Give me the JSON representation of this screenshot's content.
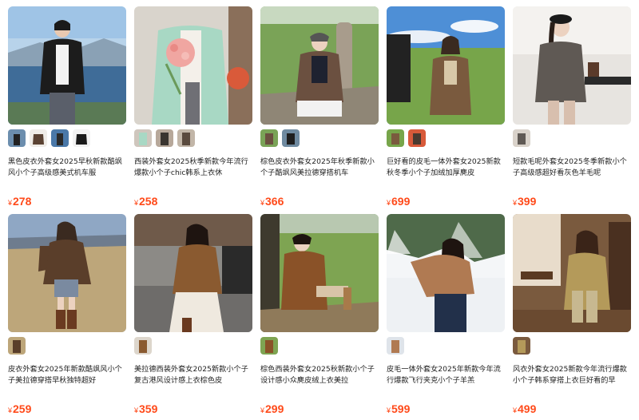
{
  "currency_symbol": "¥",
  "products": [
    {
      "title": "黑色皮衣外套女2025早秋新款酷飒风小个子高级感美式机车服",
      "price": "278",
      "thumb_count": 4
    },
    {
      "title": "西装外套女2025秋季新款今年流行爆款小个子chic韩系上衣休",
      "price": "258",
      "thumb_count": 3
    },
    {
      "title": "棕色皮衣外套女2025年秋季新款小个子酷飒风美拉德穿搭机车",
      "price": "366",
      "thumb_count": 2
    },
    {
      "title": "巨好看的皮毛一体外套女2025新款秋冬季小个子加绒加厚麂皮",
      "price": "699",
      "thumb_count": 2
    },
    {
      "title": "短款毛呢外套女2025冬季新款小个子高级感超好看灰色羊毛呢",
      "price": "399",
      "thumb_count": 1
    },
    {
      "title": "皮衣外套女2025年新款酷飒风小个子美拉德穿搭早秋独特超好",
      "price": "259",
      "thumb_count": 1
    },
    {
      "title": "美拉德西装外套女2025新款小个子复古港风设计感上衣棕色皮",
      "price": "359",
      "thumb_count": 1
    },
    {
      "title": "棕色西装外套女2025秋新款小个子设计感小众麂皮绒上衣美拉",
      "price": "299",
      "thumb_count": 1
    },
    {
      "title": "皮毛一体外套女2025年新款今年流行爆款飞行夹克小个子羊羔",
      "price": "599",
      "thumb_count": 1
    },
    {
      "title": "风衣外套女2025新款今年流行爆款小个子韩系穿搭上衣巨好看的早",
      "price": "499",
      "thumb_count": 1
    }
  ]
}
